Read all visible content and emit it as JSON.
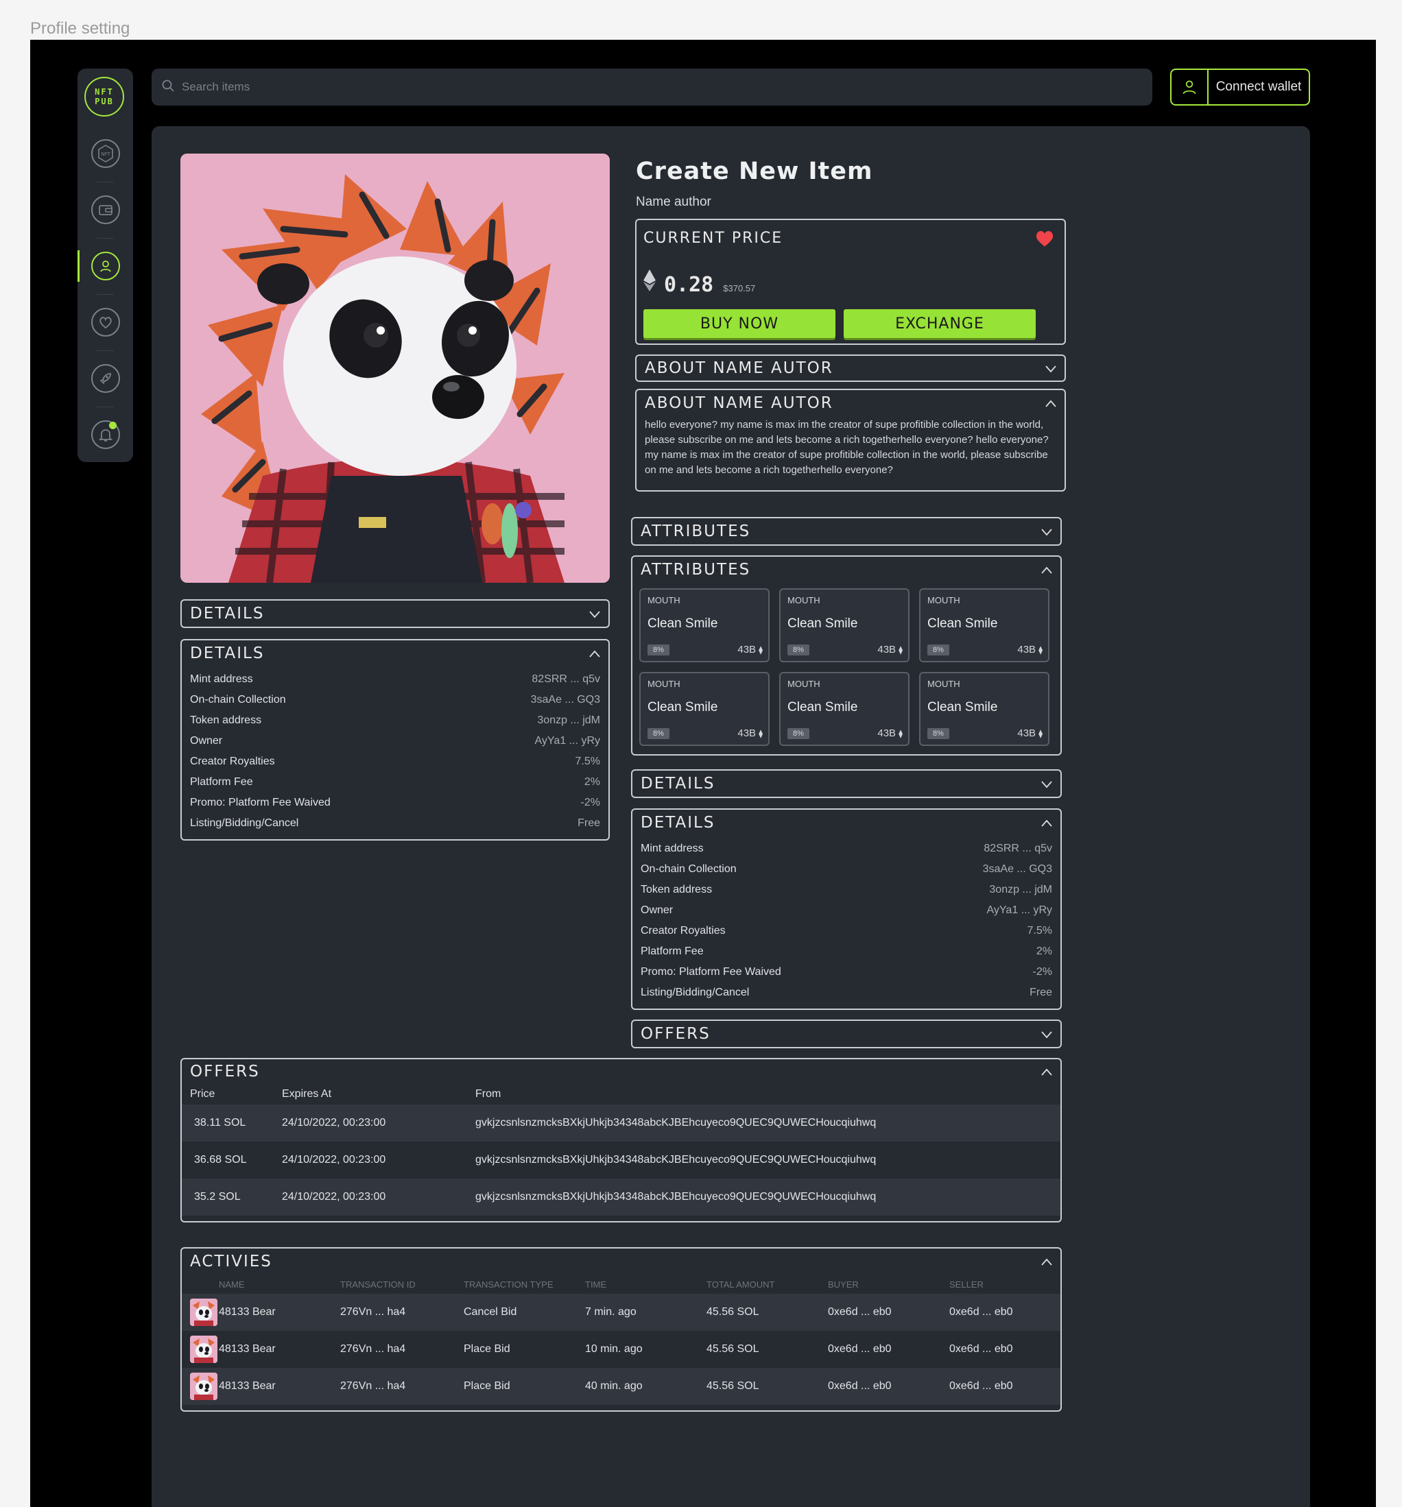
{
  "page_label": "Profile setting",
  "logo": {
    "line1": "NFT",
    "line2": "PUB"
  },
  "sidebar": {
    "items": [
      {
        "name": "nft-icon"
      },
      {
        "name": "wallet-icon"
      },
      {
        "name": "profile-icon",
        "active": true
      },
      {
        "name": "heart-icon"
      },
      {
        "name": "rocket-icon"
      },
      {
        "name": "bell-icon"
      }
    ]
  },
  "search": {
    "placeholder": "Search items"
  },
  "connect_wallet": {
    "label": "Connect wallet"
  },
  "item": {
    "title": "Create New Item",
    "author": "Name author",
    "current_price_label": "CURRENT PRICE",
    "price": "0.28",
    "price_usd": "$370.57",
    "buy_label": "BUY NOW",
    "exchange_label": "EXCHANGE"
  },
  "about": {
    "collapsed_title": "ABOUT NAME AUTOR",
    "expanded_title": "ABOUT NAME AUTOR",
    "text": "hello everyone? my name is max im the creator  of supe  profitible collection in the world, please subscribe on me  and lets become a rich togetherhello everyone? hello everyone? my name is max im the creator  of supe  profitible collection in the world, please subscribe on me  and lets become a rich togetherhello everyone?"
  },
  "attributes": {
    "collapsed_title": "ATTRIBUTES",
    "expanded_title": "ATTRIBUTES",
    "items": [
      {
        "type": "MOUTH",
        "name": "Clean Smile",
        "pct": "8%",
        "amount": "43B"
      },
      {
        "type": "MOUTH",
        "name": "Clean Smile",
        "pct": "8%",
        "amount": "43B"
      },
      {
        "type": "MOUTH",
        "name": "Clean Smile",
        "pct": "8%",
        "amount": "43B"
      },
      {
        "type": "MOUTH",
        "name": "Clean Smile",
        "pct": "8%",
        "amount": "43B"
      },
      {
        "type": "MOUTH",
        "name": "Clean Smile",
        "pct": "8%",
        "amount": "43B"
      },
      {
        "type": "MOUTH",
        "name": "Clean Smile",
        "pct": "8%",
        "amount": "43B"
      }
    ]
  },
  "details": {
    "collapsed_title": "DETAILS",
    "expanded_title": "DETAILS",
    "rows": [
      {
        "label": "Mint address",
        "value": "82SRR ... q5v"
      },
      {
        "label": "On-chain Collection",
        "value": "3saAe ... GQ3"
      },
      {
        "label": "Token address",
        "value": "3onzp ... jdM"
      },
      {
        "label": "Owner",
        "value": "AyYa1 ... yRy"
      },
      {
        "label": "Creator Royalties",
        "value": "7.5%"
      },
      {
        "label": "Platform Fee",
        "value": "2%"
      },
      {
        "label": "Promo: Platform Fee Waived",
        "value": "-2%"
      },
      {
        "label": "Listing/Bidding/Cancel",
        "value": "Free"
      }
    ]
  },
  "offers": {
    "collapsed_title": "OFFERS",
    "expanded_title": "OFFERS",
    "columns": [
      "Price",
      "Expires At",
      "From"
    ],
    "rows": [
      {
        "price": "38.11 SOL",
        "expires": "24/10/2022, 00:23:00",
        "from": "gvkjzcsnlsnzmcksBXkjUhkjb34348abcKJBEhcuyeco9QUEC9QUWECHoucqiuhwq"
      },
      {
        "price": "36.68 SOL",
        "expires": "24/10/2022, 00:23:00",
        "from": "gvkjzcsnlsnzmcksBXkjUhkjb34348abcKJBEhcuyeco9QUEC9QUWECHoucqiuhwq"
      },
      {
        "price": "35.2 SOL",
        "expires": "24/10/2022, 00:23:00",
        "from": "gvkjzcsnlsnzmcksBXkjUhkjb34348abcKJBEhcuyeco9QUEC9QUWECHoucqiuhwq"
      }
    ]
  },
  "activities": {
    "title": "ACTIVIES",
    "columns": [
      "NAME",
      "TRANSACTION ID",
      "TRANSACTION TYPE",
      "TIME",
      "TOTAL AMOUNT",
      "BUYER",
      "SELLER"
    ],
    "rows": [
      {
        "name": "48133 Bear",
        "tx": "276Vn ... ha4",
        "type": "Cancel Bid",
        "time": "7 min. ago",
        "amount": "45.56 SOL",
        "buyer": "0xe6d ... eb0",
        "seller": "0xe6d ... eb0"
      },
      {
        "name": "48133 Bear",
        "tx": "276Vn ... ha4",
        "type": "Place Bid",
        "time": "10 min. ago",
        "amount": "45.56 SOL",
        "buyer": "0xe6d ... eb0",
        "seller": "0xe6d ... eb0"
      },
      {
        "name": "48133 Bear",
        "tx": "276Vn ... ha4",
        "type": "Place Bid",
        "time": "40 min. ago",
        "amount": "45.56 SOL",
        "buyer": "0xe6d ... eb0",
        "seller": "0xe6d ... eb0"
      }
    ]
  },
  "colors": {
    "accent": "#a4e83c",
    "panel": "#262a31",
    "background": "#000000",
    "heart": "#f0434a",
    "link": "#4a90e2"
  }
}
